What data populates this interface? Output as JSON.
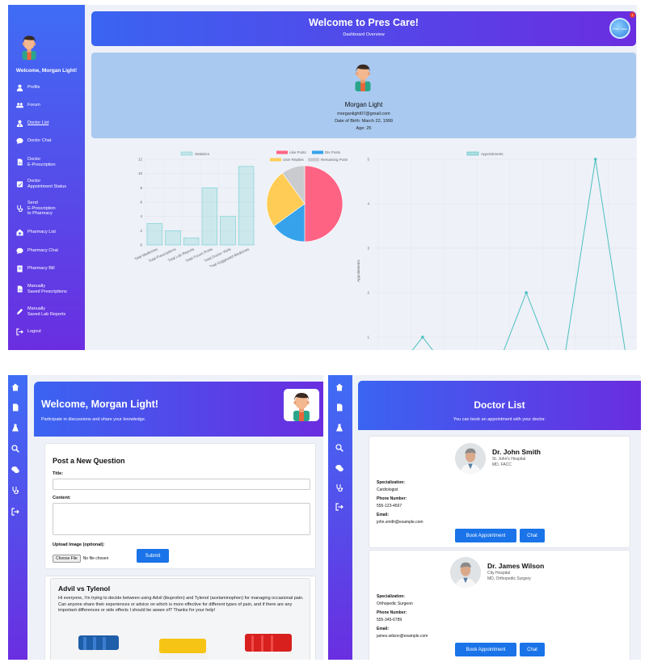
{
  "dashboard": {
    "title": "Welcome to Pres Care!",
    "subtitle": "Dashboard Overview",
    "notification_count": "1",
    "logo_text": "Pres Care",
    "sidebar": {
      "welcome": "Welcome, Morgan Light!",
      "items": [
        {
          "label": "Profile"
        },
        {
          "label": "Forum"
        },
        {
          "label": "Doctor List"
        },
        {
          "label": "Doctor Chat"
        },
        {
          "label": "Doctor\nE-Prescription"
        },
        {
          "label": "Doctor\nAppointment Status"
        },
        {
          "label": "Send\nE-Prescription\nto Pharmacy"
        },
        {
          "label": "Pharmacy List"
        },
        {
          "label": "Pharmacy Chat"
        },
        {
          "label": "Pharmacy Bill"
        },
        {
          "label": "Manually\nSaved Prescriptions"
        },
        {
          "label": "Manually\nSaved Lab Reports"
        },
        {
          "label": "Logout"
        }
      ]
    },
    "profile": {
      "name": "Morgan Light",
      "email": "morganlight07@gmail.com",
      "dob": "Date of Birth: March 22, 1999",
      "age": "Age: 25"
    }
  },
  "chart_data": [
    {
      "type": "bar",
      "series": [
        {
          "name": "Statistics",
          "values": [
            3,
            2,
            1,
            8,
            4,
            11
          ]
        }
      ],
      "categories": [
        "Total Medicines",
        "Total Prescriptions",
        "Total Lab Reports",
        "Total Forum Posts",
        "Total Doctor Visits",
        "Total Suggested Medicines"
      ],
      "ylim": [
        0,
        12
      ],
      "yticks": [
        "0",
        "2",
        "4",
        "6",
        "8",
        "10",
        "12"
      ],
      "color": "#7fd3d3"
    },
    {
      "type": "pie",
      "labels": [
        "Like Posts",
        "Dis Posts",
        "User Replies",
        "Remaining Posts"
      ],
      "values": [
        50,
        15,
        25,
        10
      ],
      "colors": [
        "#ff6384",
        "#36a2eb",
        "#ffcd56",
        "#c9cbcf"
      ]
    },
    {
      "type": "line",
      "series": [
        {
          "name": "Appointments",
          "values": [
            0,
            1,
            0,
            0,
            2,
            0,
            5,
            0
          ]
        }
      ],
      "ylabel": "Appointments",
      "ylim": [
        0,
        5
      ],
      "yticks": [
        "1",
        "2",
        "3",
        "4",
        "5"
      ],
      "color": "#4bc0c0"
    }
  ],
  "forum": {
    "title": "Welcome, Morgan Light!",
    "subtitle": "Participate in discussions and share your knowledge.",
    "post_heading": "Post a New Question",
    "title_label": "Title:",
    "content_label": "Content:",
    "upload_label": "Upload Image (optional):",
    "choose_file": "Choose File",
    "no_file": "No file chosen",
    "submit": "Submit",
    "question": {
      "title": "Advil vs Tylenol",
      "body": "Hi everyone, I'm trying to decide between using Advil (ibuprofen) and Tylenol (acetaminophen) for managing occasional pain. Can anyone share their experiences or advice on which is more effective for different types of pain, and if there are any important differences or side effects I should be aware of? Thanks for your help!"
    }
  },
  "doctor_list": {
    "title": "Doctor List",
    "subtitle": "You can book an appointment with your doctor.",
    "labels": {
      "spec": "Specialization:",
      "phone": "Phone Number:",
      "email": "Email:"
    },
    "book": "Book Appointment",
    "chat": "Chat",
    "doctors": [
      {
        "name": "Dr. John Smith",
        "hospital": "St. John's Hospital",
        "degree": "MD, FACC",
        "spec": "Cardiologist",
        "phone": "555-123-4567",
        "email": "john.smith@example.com"
      },
      {
        "name": "Dr. James Wilson",
        "hospital": "City Hospital",
        "degree": "MD, Orthopedic Surgery",
        "spec": "Orthopedic Surgeon",
        "phone": "555-345-6789",
        "email": "james.wilson@example.com"
      }
    ]
  }
}
